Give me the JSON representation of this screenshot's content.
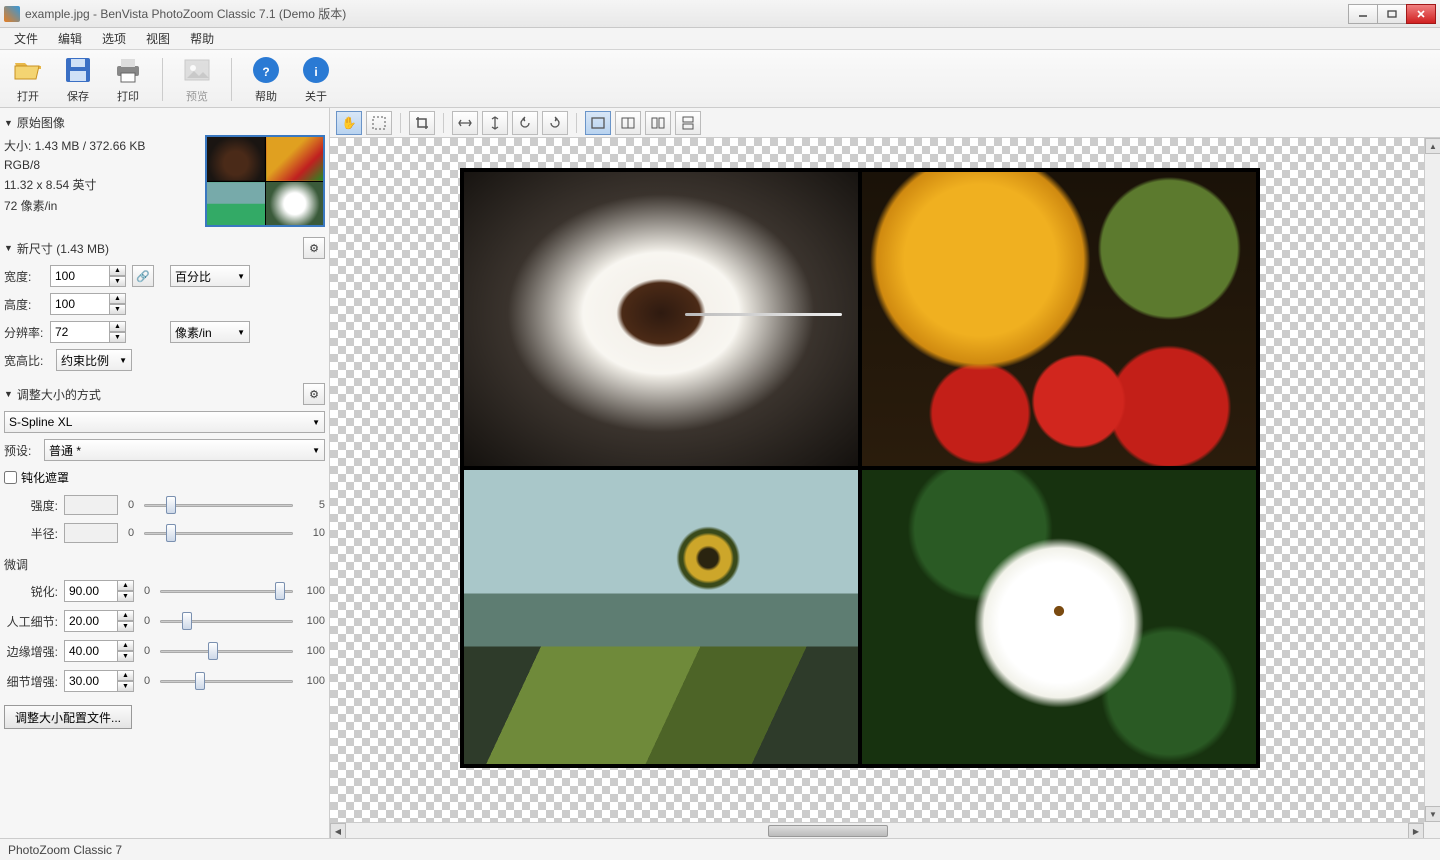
{
  "window": {
    "title": "example.jpg - BenVista PhotoZoom Classic 7.1 (Demo 版本)"
  },
  "menu": {
    "items": [
      "文件",
      "编辑",
      "选项",
      "视图",
      "帮助"
    ]
  },
  "toolbar": {
    "open": "打开",
    "save": "保存",
    "print": "打印",
    "preview": "预览",
    "help": "帮助",
    "about": "关于"
  },
  "original": {
    "header": "原始图像",
    "size_line": "大小: 1.43 MB / 372.66 KB",
    "mode": "RGB/8",
    "dims": "11.32 x 8.54 英寸",
    "dpi": "72 像素/in"
  },
  "newsize": {
    "header": "新尺寸 (1.43 MB)",
    "width_label": "宽度:",
    "width_value": "100",
    "height_label": "高度:",
    "height_value": "100",
    "unit1": "百分比",
    "res_label": "分辨率:",
    "res_value": "72",
    "unit2": "像素/in",
    "aspect_label": "宽高比:",
    "aspect_value": "约束比例"
  },
  "resize_method": {
    "header": "调整大小的方式",
    "algorithm": "S-Spline XL",
    "preset_label": "预设:",
    "preset_value": "普通 *"
  },
  "unsharp": {
    "checkbox": "钝化遮罩",
    "strength_label": "强度:",
    "strength_min": "0",
    "strength_max": "5",
    "radius_label": "半径:",
    "radius_min": "0",
    "radius_max": "10"
  },
  "finetune": {
    "header": "微调",
    "sharpen_label": "锐化:",
    "sharpen_value": "90.00",
    "detail_label": "人工细节:",
    "detail_value": "20.00",
    "edge_label": "边缘增强:",
    "edge_value": "40.00",
    "detail2_label": "细节增强:",
    "detail2_value": "30.00",
    "min": "0",
    "max": "100"
  },
  "profile_button": "调整大小配置文件...",
  "status": "PhotoZoom Classic 7"
}
